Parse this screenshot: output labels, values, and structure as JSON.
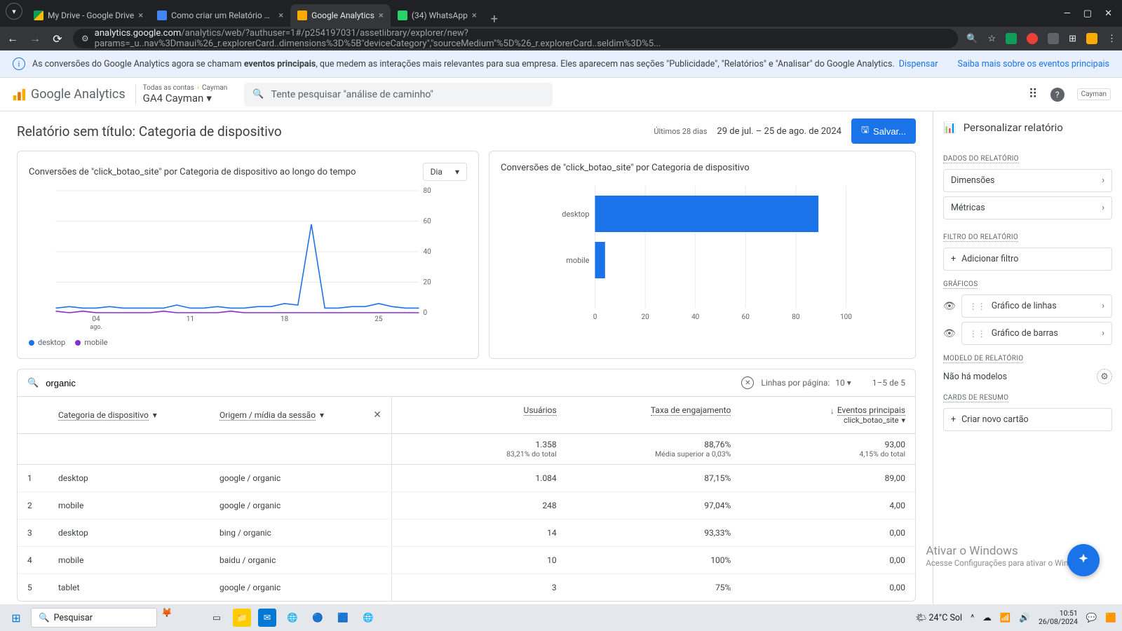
{
  "browser": {
    "tabs": [
      {
        "title": "My Drive - Google Drive"
      },
      {
        "title": "Como criar um Relatório no Go"
      },
      {
        "title": "Google Analytics"
      },
      {
        "title": "(34) WhatsApp"
      }
    ],
    "url_domain": "analytics.google.com",
    "url_path": "/analytics/web/?authuser=1#/p254197031/assetlibrary/explorer/new?params=_u..nav%3Dmaui%26_r.explorerCard..dimensions%3D%5B\"deviceCategory\",\"sourceMedium\"%5D%26_r.explorerCard..seldim%3D%5..."
  },
  "info_banner": {
    "text_pre": "As conversões do Google Analytics agora se chamam ",
    "text_bold": "eventos principais",
    "text_post": ", que medem as interações mais relevantes para sua empresa. Eles aparecem nas seções \"Publicidade\", \"Relatórios\" e \"Analisar\" do Google Analytics.",
    "dismiss": "Dispensar",
    "learn_more": "Saiba mais sobre os eventos principais"
  },
  "ga_header": {
    "logo": "Google Analytics",
    "breadcrumb_a": "Todas as contas",
    "breadcrumb_b": "Cayman",
    "property": "GA4 Cayman",
    "search_placeholder": "Tente pesquisar \"análise de caminho\"",
    "account_chip": "Cayman"
  },
  "report": {
    "title": "Relatório sem título: Categoria de dispositivo",
    "range_label": "Últimos 28 dias",
    "range": "29 de jul. – 25 de ago. de 2024",
    "save": "Salvar..."
  },
  "chart_data": [
    {
      "type": "line",
      "title": "Conversões de \"click_botao_site\" por Categoria de dispositivo ao longo do tempo",
      "granularity": "Dia",
      "ylim": [
        0,
        80
      ],
      "yticks": [
        0,
        20,
        40,
        60,
        80
      ],
      "xticks": [
        "04",
        "11",
        "18",
        "25"
      ],
      "xsub": "ago.",
      "series": [
        {
          "name": "desktop",
          "color": "#1a73e8",
          "values": [
            3,
            4,
            3,
            3,
            4,
            3,
            3,
            3,
            3,
            5,
            3,
            3,
            4,
            3,
            3,
            4,
            4,
            6,
            5,
            58,
            3,
            3,
            4,
            4,
            6,
            4,
            3,
            3
          ]
        },
        {
          "name": "mobile",
          "color": "#8430ce",
          "values": [
            1,
            0,
            1,
            0,
            0,
            0,
            0,
            0,
            1,
            0,
            0,
            0,
            0,
            1,
            0,
            0,
            0,
            0,
            0,
            0,
            0,
            0,
            0,
            0,
            0,
            0,
            0,
            0
          ]
        }
      ]
    },
    {
      "type": "bar",
      "title": "Conversões de \"click_botao_site\" por Categoria de dispositivo",
      "orientation": "horizontal",
      "xlim": [
        0,
        100
      ],
      "xticks": [
        0,
        20,
        40,
        60,
        80,
        100
      ],
      "categories": [
        "desktop",
        "mobile"
      ],
      "values": [
        89,
        4
      ],
      "color": "#1a73e8"
    }
  ],
  "table": {
    "search_value": "organic",
    "rows_per_label": "Linhas por página:",
    "rows_per_value": "10",
    "page_info": "1–5 de 5",
    "dim1": "Categoria de dispositivo",
    "dim2": "Origem / mídia da sessão",
    "metrics": [
      {
        "label": "Usuários"
      },
      {
        "label": "Taxa de engajamento"
      },
      {
        "label": "Eventos principais",
        "sub": "click_botao_site"
      }
    ],
    "totals": {
      "users": "1.358",
      "users_sub": "83,21% do total",
      "eng": "88,76%",
      "eng_sub": "Média superior a 0,03%",
      "ev": "93,00",
      "ev_sub": "4,15% do total"
    },
    "rows": [
      {
        "idx": "1",
        "d1": "desktop",
        "d2": "google / organic",
        "users": "1.084",
        "eng": "87,15%",
        "ev": "89,00"
      },
      {
        "idx": "2",
        "d1": "mobile",
        "d2": "google / organic",
        "users": "248",
        "eng": "97,04%",
        "ev": "4,00"
      },
      {
        "idx": "3",
        "d1": "desktop",
        "d2": "bing / organic",
        "users": "14",
        "eng": "93,33%",
        "ev": "0,00"
      },
      {
        "idx": "4",
        "d1": "mobile",
        "d2": "baidu / organic",
        "users": "10",
        "eng": "100%",
        "ev": "0,00"
      },
      {
        "idx": "5",
        "d1": "tablet",
        "d2": "google / organic",
        "users": "3",
        "eng": "75%",
        "ev": "0,00"
      }
    ]
  },
  "side": {
    "title": "Personalizar relatório",
    "section_data": "DADOS DO RELATÓRIO",
    "dim": "Dimensões",
    "met": "Métricas",
    "section_filter": "FILTRO DO RELATÓRIO",
    "add_filter": "Adicionar filtro",
    "section_charts": "GRÁFICOS",
    "chart_line": "Gráfico de linhas",
    "chart_bar": "Gráfico de barras",
    "section_model": "MODELO DE RELATÓRIO",
    "no_models": "Não há modelos",
    "section_summary": "CARDS DE RESUMO",
    "new_card": "Criar novo cartão"
  },
  "watermark": {
    "l1": "Ativar o Windows",
    "l2": "Acesse Configurações para ativar o Windows."
  },
  "taskbar": {
    "search": "Pesquisar",
    "weather": "24°C  Sol",
    "time": "10:51",
    "date": "26/08/2024"
  }
}
